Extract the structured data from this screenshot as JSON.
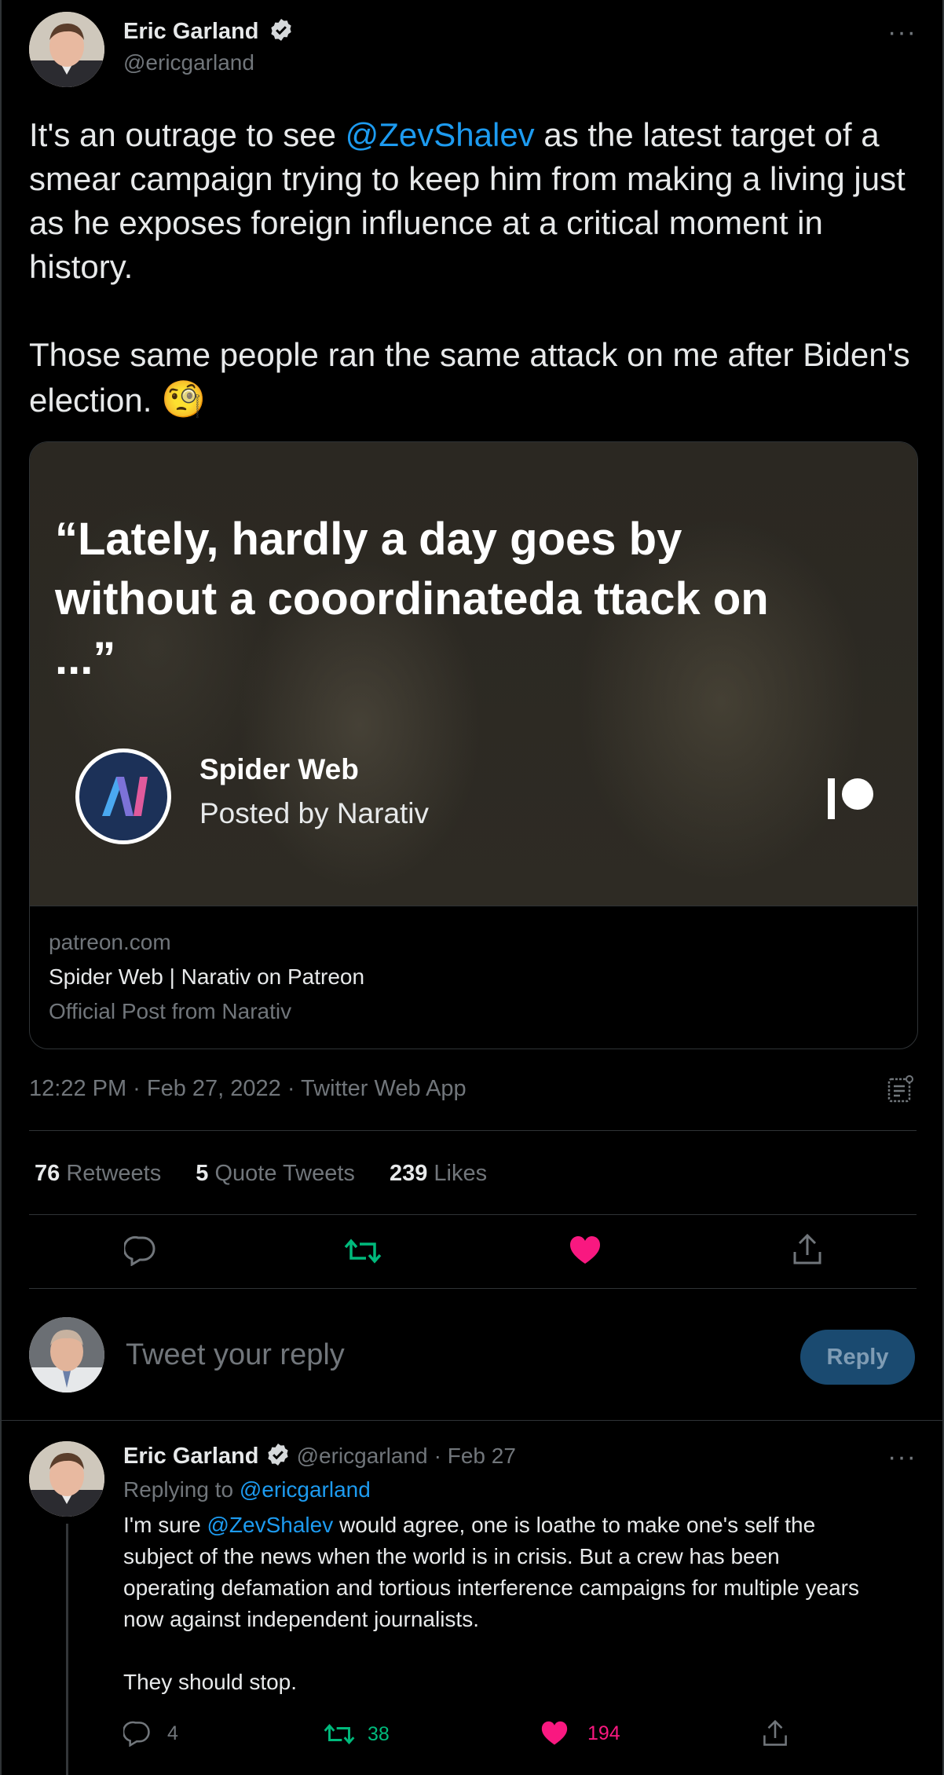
{
  "main_tweet": {
    "author": {
      "name": "Eric Garland",
      "handle": "@ericgarland"
    },
    "text": {
      "line1_before": "It's an outrage to see ",
      "mention": "@ZevShalev",
      "line1_after": " as the latest target of a smear campaign trying to keep him from making a living just as he exposes foreign influence at a critical moment in history.",
      "para2": "Those same people ran the same attack on me after Biden's election.",
      "emoji": "🧐"
    },
    "card": {
      "quote": "“Lately, hardly a day goes by without a cooordinateda ttack on ...”",
      "creator_name": "Spider Web",
      "posted_by": "Posted by Narativ",
      "domain": "patreon.com",
      "title": "Spider Web | Narativ on Patreon",
      "description": "Official Post from Narativ"
    },
    "timestamp": "12:22 PM · Feb 27, 2022 · Twitter Web App",
    "stats": {
      "retweets": "76",
      "retweets_label": "Retweets",
      "quotes": "5",
      "quotes_label": "Quote Tweets",
      "likes": "239",
      "likes_label": "Likes"
    }
  },
  "reply_box": {
    "placeholder": "Tweet your reply",
    "button": "Reply"
  },
  "reply_tweet": {
    "author": {
      "name": "Eric Garland",
      "handle": "@ericgarland"
    },
    "date_sep": "· Feb 27",
    "replying_label": "Replying to",
    "replying_to": "@ericgarland",
    "text_before": "I'm sure ",
    "mention": "@ZevShalev",
    "text_after": " would agree, one is loathe to make one's self the subject of the news when the world is in crisis. But a crew has been operating defamation and tortious interference campaigns for multiple years now against independent journalists.",
    "text_p2": "They should stop.",
    "replies": "4",
    "retweets": "38",
    "likes": "194"
  },
  "more_label": "···",
  "colors": {
    "accent": "#1d9bf0",
    "like": "#f91880",
    "retweet": "#00ba7c",
    "muted": "#71767b",
    "bg": "#000000"
  },
  "icons": [
    "verified-badge-icon",
    "more-icon",
    "reply-icon",
    "retweet-icon",
    "like-icon",
    "share-icon",
    "analytics-icon",
    "patreon-logo-icon",
    "narativ-logo-icon"
  ]
}
